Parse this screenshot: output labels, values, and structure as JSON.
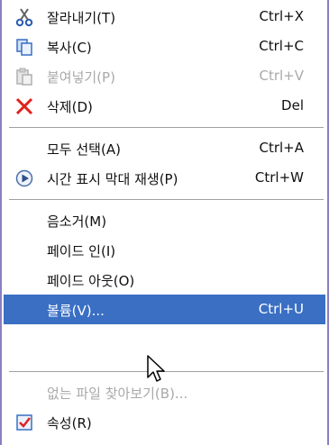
{
  "menu": {
    "items": [
      {
        "label": "잘라내기(T)",
        "shortcut": "Ctrl+X",
        "icon": "scissors-icon"
      },
      {
        "label": "복사(C)",
        "shortcut": "Ctrl+C",
        "icon": "copy-icon"
      },
      {
        "label": "붙여넣기(P)",
        "shortcut": "Ctrl+V",
        "icon": "paste-icon",
        "disabled": true
      },
      {
        "label": "삭제(D)",
        "shortcut": "Del",
        "icon": "delete-x-icon"
      },
      {
        "label": "모두 선택(A)",
        "shortcut": "Ctrl+A"
      },
      {
        "label": "시간 표시 막대 재생(P)",
        "shortcut": "Ctrl+W",
        "icon": "play-circle-icon"
      },
      {
        "label": "음소거(M)",
        "shortcut": ""
      },
      {
        "label": "페이드 인(I)",
        "shortcut": ""
      },
      {
        "label": "페이드 아웃(O)",
        "shortcut": ""
      },
      {
        "label": "볼륨(V)...",
        "shortcut": "Ctrl+U",
        "highlighted": true
      },
      {
        "label": "없는 파일 찾아보기(B)...",
        "shortcut": "",
        "disabled": true
      },
      {
        "label": "속성(R)",
        "shortcut": "",
        "icon": "properties-check-icon"
      }
    ]
  },
  "colors": {
    "highlight": "#3a6fc4",
    "border": "#8a7fbf",
    "disabled": "#a9a9a9"
  }
}
